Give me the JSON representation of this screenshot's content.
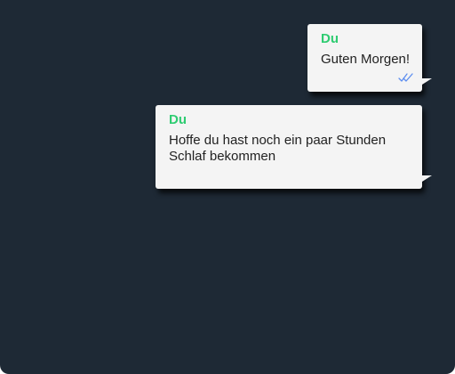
{
  "colors": {
    "background": "#1e2935",
    "bubble": "#f4f4f4",
    "sender": "#2ecc71",
    "read_ticks": "#5d8ef0",
    "text": "#222222"
  },
  "messages": [
    {
      "sender": "Du",
      "text": "Guten Morgen!",
      "status_icon": "double-check-icon"
    },
    {
      "sender": "Du",
      "text": "Hoffe du hast noch ein paar Stunden Schlaf bekommen"
    }
  ]
}
